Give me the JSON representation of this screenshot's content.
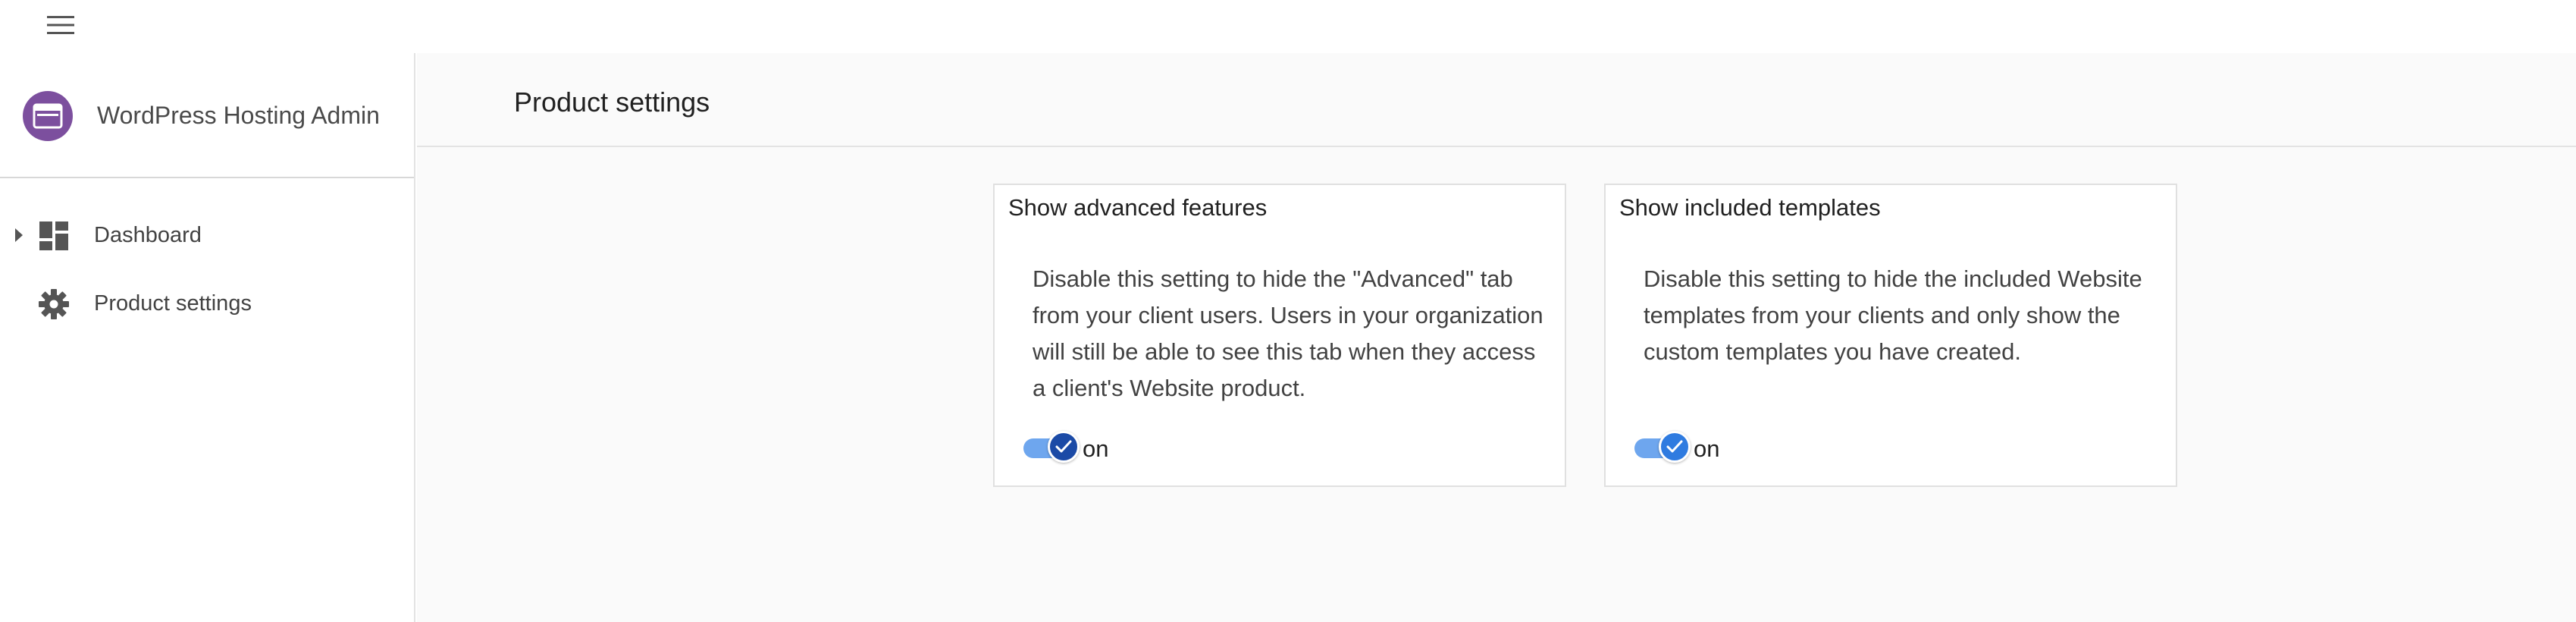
{
  "app": {
    "title": "WordPress Hosting Admin",
    "brand_color": "#7c4f9e",
    "accent_color": "#1b4aa6"
  },
  "topbar": {
    "menu_icon": "hamburger-menu-icon"
  },
  "sidebar": {
    "items": [
      {
        "label": "Dashboard",
        "icon": "dashboard-icon",
        "expandable": true
      },
      {
        "label": "Product settings",
        "icon": "gear-icon",
        "expandable": false
      }
    ]
  },
  "main": {
    "page_title": "Product settings",
    "cards": [
      {
        "title": "Show advanced features",
        "description": "Disable this setting to hide the \"Advanced\" tab from your client users. Users in your organization will still be able to see this tab when they access a client's Website product.",
        "toggle_state": "on",
        "toggle_enabled": true
      },
      {
        "title": "Show included templates",
        "description": "Disable this setting to hide the included Website templates from your clients and only show the custom templates you have created.",
        "toggle_state": "on",
        "toggle_enabled": true
      }
    ]
  }
}
